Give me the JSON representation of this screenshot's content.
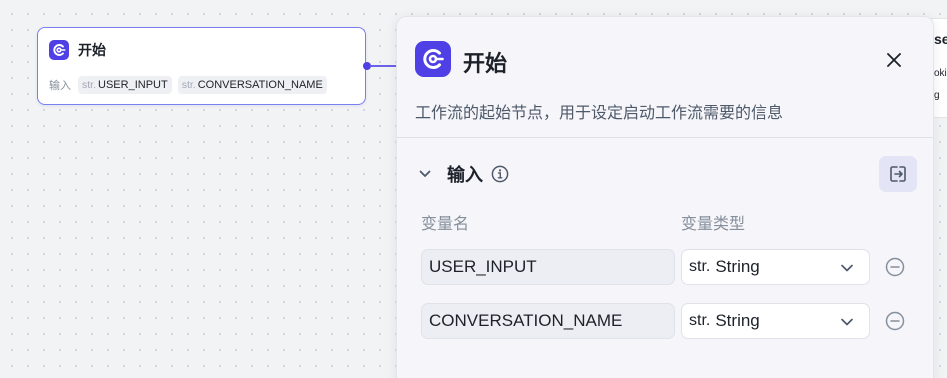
{
  "canvas": {
    "start_node": {
      "title": "开始",
      "inputs_label": "输入",
      "variables": [
        {
          "type_prefix": "str.",
          "name": "USER_INPUT"
        },
        {
          "type_prefix": "str.",
          "name": "CONVERSATION_NAME"
        }
      ]
    },
    "right_node": {
      "title_fragment": "se",
      "row1_fragment": "oki",
      "row2_fragment": "g"
    }
  },
  "panel": {
    "title": "开始",
    "description": "工作流的起始节点，用于设定启动工作流需要的信息",
    "section": {
      "title": "输入",
      "columns": {
        "name": "变量名",
        "type": "变量类型"
      },
      "rows": [
        {
          "name": "USER_INPUT",
          "type_prefix": "str.",
          "type": "String"
        },
        {
          "name": "CONVERSATION_NAME",
          "type_prefix": "str.",
          "type": "String"
        }
      ]
    }
  },
  "icons": {
    "node_icon": "start-node-icon",
    "close": "close-icon",
    "collapse": "chevron-down-icon",
    "info": "info-icon",
    "header_action": "export-icon",
    "remove": "minus-circle-icon"
  },
  "colors": {
    "accent": "#4e40e5",
    "node_border": "#7a7ef0",
    "panel_bg": "#f5f5fa",
    "canvas_bg": "#f2f3f5"
  }
}
